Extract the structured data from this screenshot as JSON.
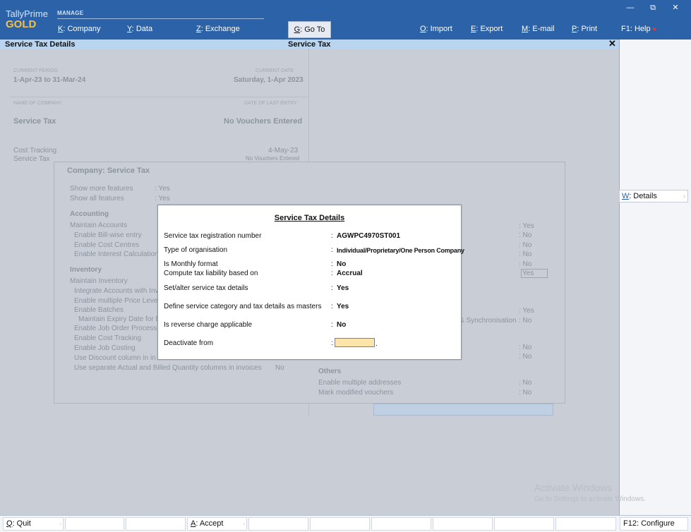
{
  "brand": {
    "line1": "TallyPrime",
    "line2": "GOLD"
  },
  "topmenu": {
    "manage": "MANAGE",
    "company_key": "K",
    "company_label": ": Company",
    "data_key": "Y",
    "data_label": ": Data",
    "exchange_key": "Z",
    "exchange_label": ": Exchange",
    "goto_key": "G",
    "goto_label": ": Go To",
    "import_key": "O",
    "import_label": ": Import",
    "export_key": "E",
    "export_label": ": Export",
    "email_key": "M",
    "email_label": ": E-mail",
    "print_key": "P",
    "print_label": ": Print",
    "help_label": "F1: Help"
  },
  "window_controls": {
    "minimize": "—",
    "restore": "⧉",
    "close": "✕"
  },
  "titlebar": {
    "left": "Service Tax Details",
    "center": "Service Tax",
    "close": "✕"
  },
  "right_panel": {
    "details_key": "W",
    "details_label": ": Details"
  },
  "background": {
    "current_period_label": "CURRENT PERIOD",
    "current_period": "1-Apr-23 to 31-Mar-24",
    "current_date_label": "CURRENT DATE",
    "current_date": "Saturday, 1-Apr 2023",
    "name_of_company_label": "NAME OF COMPANY",
    "date_of_last_entry_label": "DATE OF LAST ENTRY",
    "company_name": "Service Tax",
    "last_entry": "No Vouchers Entered",
    "cost_tracking": "Cost Tracking",
    "cost_tracking_date": "4-May-23",
    "service_tax_row": "Service Tax",
    "service_tax_row_val": "No Vouchers Entered",
    "company_panel_title": "Company: Service Tax",
    "show_more": "Show more features",
    "show_more_val": ": Yes",
    "show_all": "Show all features",
    "show_all_val": ": Yes",
    "accounting": "Accounting",
    "maintain_accounts": "Maintain Accounts",
    "enable_bill_wise": "Enable Bill-wise entry",
    "enable_cost_centres": "Enable Cost Centres",
    "enable_interest": "Enable Interest Calculation",
    "inventory": "Inventory",
    "maintain_inventory": "Maintain Inventory",
    "integrate_accounts": "Integrate Accounts with Inv",
    "enable_price_levels": "Enable multiple Price Level",
    "enable_batches": "Enable Batches",
    "maintain_expiry": "Maintain Expiry Date for B",
    "enable_job_order": "Enable Job Order Process",
    "enable_cost_tracking": "Enable Cost Tracking",
    "enable_job_costing": "Enable Job Costing",
    "use_discount": "Use Discount column in in",
    "use_separate": "Use separate Actual and Billed Quantity columns in invoices",
    "use_separate_val": "No",
    "right_yes1": ": Yes",
    "right_no1": ": No",
    "right_no2": ": No",
    "right_no3": ": No",
    "right_no4": ": No",
    "right_yes_box": "Yes",
    "right_yes2": ": Yes",
    "sync_label": "& Synchronisation",
    "sync_val": ": No",
    "right_no5": ": No",
    "right_no6": ": No",
    "others": "Others",
    "enable_multi_addr": "Enable multiple addresses",
    "enable_multi_addr_val": ": No",
    "mark_modified": "Mark modified vouchers",
    "mark_modified_val": ": No"
  },
  "modal": {
    "title": "Service Tax Details",
    "rows": [
      {
        "label": "Service tax registration number",
        "colon": ":",
        "value": "AGWPC4970ST001"
      },
      {
        "label": "Type of organisation",
        "colon": ":",
        "value": "Individual/Proprietary/One Person Company"
      },
      {
        "label": "Is Monthly format",
        "colon": ":",
        "value": "No"
      },
      {
        "label": "Compute tax liability based on",
        "colon": ":",
        "value": "Accrual"
      },
      {
        "label": "Set/alter service tax details",
        "colon": ":",
        "value": "Yes"
      },
      {
        "label": "Define service category and tax details as masters",
        "colon": ":",
        "value": "Yes"
      },
      {
        "label": "Is reverse charge applicable",
        "colon": ":",
        "value": "No"
      },
      {
        "label": "Deactivate from",
        "colon": ":",
        "value": ""
      }
    ]
  },
  "watermark": {
    "line1": "Activate Windows",
    "line2": "Go to Settings to activate Windows."
  },
  "bottombar": {
    "quit_key": "Q",
    "quit_label": ": Quit",
    "accept_key": "A",
    "accept_label": ": Accept",
    "configure_label": "F12: Configure"
  }
}
